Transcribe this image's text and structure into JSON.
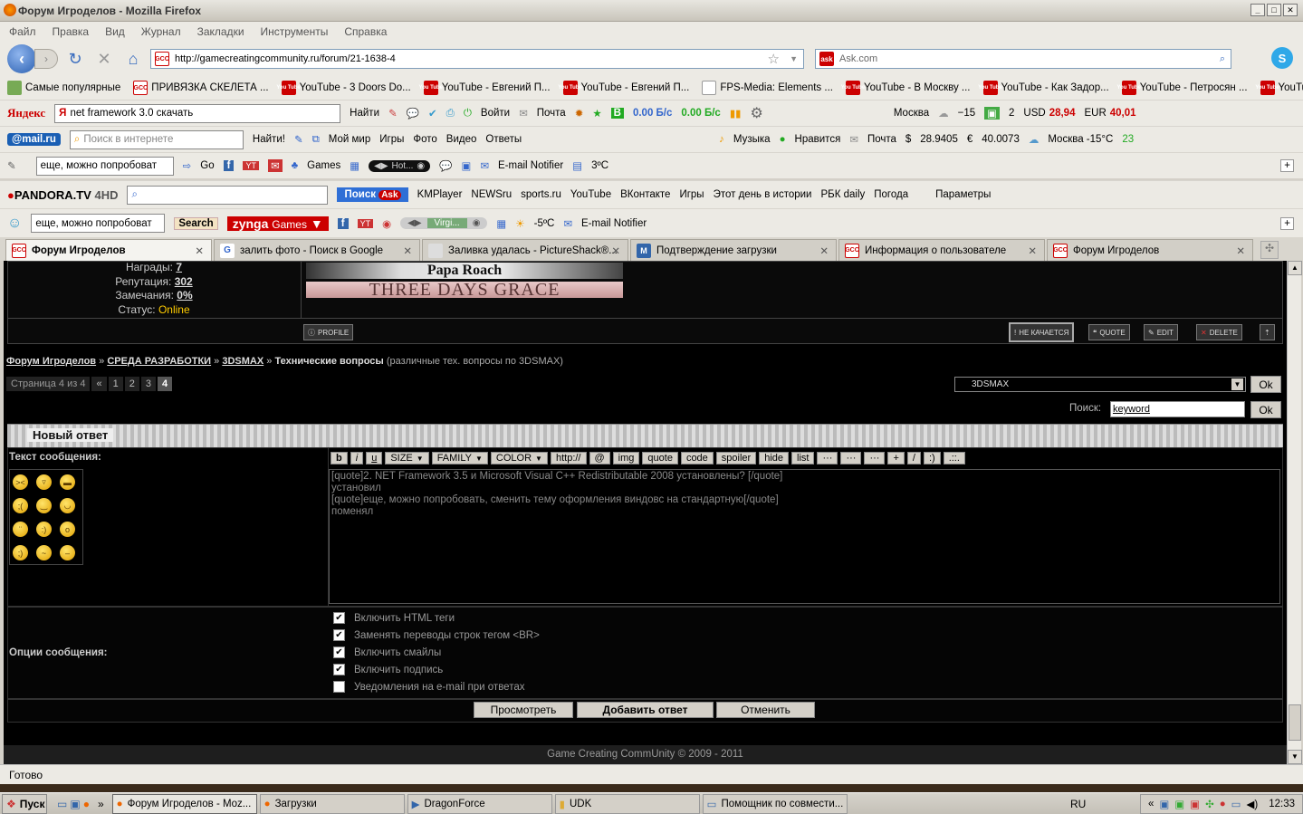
{
  "window": {
    "title": "Форум Игроделов - Mozilla Firefox"
  },
  "menu": [
    "Файл",
    "Правка",
    "Вид",
    "Журнал",
    "Закладки",
    "Инструменты",
    "Справка"
  ],
  "nav": {
    "url": "http://gamecreatingcommunity.ru/forum/21-1638-4",
    "search_engine": "Ask.com"
  },
  "bookmarks": [
    {
      "icon": "folder-icon",
      "label": "Самые популярные"
    },
    {
      "icon": "gcc-icon",
      "label": "ПРИВЯЗКА СКЕЛЕТА ..."
    },
    {
      "icon": "youtube-icon",
      "label": "YouTube - 3 Doors Do..."
    },
    {
      "icon": "youtube-icon",
      "label": "YouTube - Евгений П..."
    },
    {
      "icon": "youtube-icon",
      "label": "YouTube - Евгений П..."
    },
    {
      "icon": "page-icon",
      "label": "FPS-Media: Elements ..."
    },
    {
      "icon": "youtube-icon",
      "label": "YouTube - В Москву ..."
    },
    {
      "icon": "youtube-icon",
      "label": "YouTube - Как Задор..."
    },
    {
      "icon": "youtube-icon",
      "label": "YouTube - Петросян ..."
    },
    {
      "icon": "youtube-icon",
      "label": "YouTube - Михаил За..."
    }
  ],
  "yandex": {
    "logo": "Яндекс",
    "query": "net framework 3.0 скачать",
    "find": "Найти",
    "login": "Войти",
    "mail": "Почта",
    "speed1": "0.00 Б/с",
    "speed2": "0.00 Б/с",
    "city": "Москва",
    "temp": "−15",
    "count": "2",
    "usd_label": "USD",
    "usd": "28,94",
    "eur_label": "EUR",
    "eur": "40,01"
  },
  "mailru": {
    "logo": "@mail.ru",
    "placeholder": "Поиск в интернете",
    "find": "Найти!",
    "items": [
      "Мой мир",
      "Игры",
      "Фото",
      "Видео",
      "Ответы"
    ],
    "right": [
      "Музыка",
      "Нравится",
      "Почта",
      "28.9405",
      "40.0073",
      "Москва -15°C",
      "23"
    ]
  },
  "tb3": {
    "query": "еще, можно попробоват",
    "go": "Go",
    "games": "Games",
    "player": "Hot...",
    "email": "E-mail Notifier",
    "temp": "3ºC"
  },
  "pandora": {
    "logo": "PANDORA.TV",
    "hd": "4HD",
    "search": "Поиск",
    "items": [
      "KMPlayer",
      "NEWSru",
      "sports.ru",
      "YouTube",
      "ВКонтакте",
      "Игры",
      "Этот день в истории",
      "РБК daily",
      "Погода",
      "Параметры"
    ]
  },
  "tb5": {
    "query": "еще, можно попробоват",
    "search": "Search",
    "zynga": "zynga",
    "games": "Games",
    "radio": "Virgi...",
    "temp": "-5ºC",
    "email": "E-mail Notifier"
  },
  "tabs": [
    {
      "label": "Форум Игроделов",
      "active": true
    },
    {
      "label": "залить фото - Поиск в Google",
      "active": false
    },
    {
      "label": "Заливка удалась - PictureShack®...",
      "active": false
    },
    {
      "label": "Подтверждение загрузки",
      "active": false
    },
    {
      "label": "Информация о пользователе",
      "active": false
    },
    {
      "label": "Форум Игроделов",
      "active": false
    }
  ],
  "post": {
    "awards_label": "Награды:",
    "awards": "7",
    "rep_label": "Репутация:",
    "rep": "302",
    "warn_label": "Замечания:",
    "warn": "0%",
    "status_label": "Статус:",
    "status": "Online",
    "banner1": "Papa Roach",
    "banner2": "THREE DAYS GRACE",
    "profile": "PROFILE",
    "dislike": "НЕ КАЧАЕТСЯ",
    "quote": "QUOTE",
    "edit": "EDIT",
    "delete": "DELETE"
  },
  "breadcrumb": {
    "forum": "Форум Игроделов",
    "section": "СРЕДА РАЗРАБОТКИ",
    "sub": "3DSMAX",
    "topic": "Технические вопросы",
    "desc": "(различные тех. вопросы по 3DSMAX)",
    "sep": "»"
  },
  "pager": {
    "label": "Страница 4 из 4",
    "prev": "«",
    "pages": [
      "1",
      "2",
      "3",
      "4"
    ],
    "current": "4"
  },
  "jump": {
    "selected": "3DSMAX",
    "ok": "Ok"
  },
  "search": {
    "label": "Поиск:",
    "value": "keyword",
    "ok": "Ok"
  },
  "reply": {
    "header": "Новый ответ",
    "text_label": "Текст сообщения:",
    "options_label": "Опции сообщения:"
  },
  "bbcode": [
    "b",
    "i",
    "u",
    "SIZE",
    "FAMILY",
    "COLOR",
    "http://",
    "@",
    "img",
    "quote",
    "code",
    "spoiler",
    "hide",
    "list",
    "···",
    "···",
    "···",
    "+",
    "/",
    ":)",
    ".::."
  ],
  "message": [
    "[quote]2. NET Framework 3.5 и Microsoft Visual C++ Redistributable 2008 установлены? [/quote]",
    "установил",
    "[quote]еще, можно попробовать, сменить тему оформления виндовс на стандартную[/quote]",
    "поменял"
  ],
  "smileys": [
    "angry",
    "biggrin",
    "cool",
    "cry",
    "sad",
    "happy",
    "confused",
    "smile",
    "surprised",
    "wink",
    "sick",
    "tongue"
  ],
  "options": [
    {
      "label": "Включить HTML теги",
      "checked": true
    },
    {
      "label": "Заменять переводы строк тегом <BR>",
      "checked": true
    },
    {
      "label": "Включить смайлы",
      "checked": true
    },
    {
      "label": "Включить подпись",
      "checked": true
    },
    {
      "label": "Уведомления на e-mail при ответах",
      "checked": false
    }
  ],
  "buttons": {
    "preview": "Просмотреть",
    "submit": "Добавить ответ",
    "cancel": "Отменить"
  },
  "footer": "Game Creating CommUnity © 2009 - 2011",
  "status": "Готово",
  "taskbar": {
    "start": "Пуск",
    "tasks": [
      "Форум Игроделов - Moz...",
      "Загрузки",
      "DragonForce",
      "UDK",
      "Помощник по совмести..."
    ],
    "lang": "RU",
    "time": "12:33"
  }
}
